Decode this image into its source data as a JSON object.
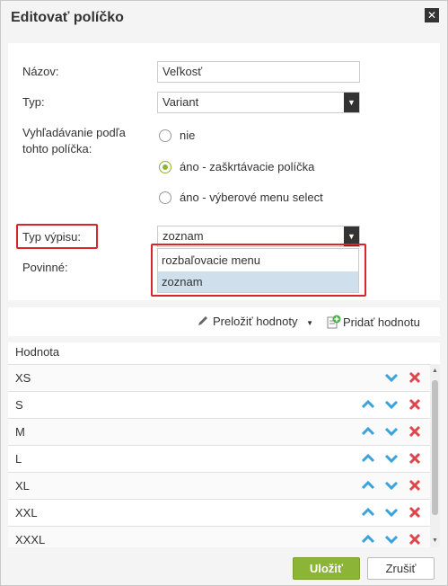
{
  "dialog": {
    "title": "Editovať políčko",
    "close_glyph": "✕"
  },
  "form": {
    "name_label": "Názov:",
    "name_value": "Veľkosť",
    "type_label": "Typ:",
    "type_value": "Variant",
    "search_label_line1": "Vyhľadávanie podľa",
    "search_label_line2": "tohto políčka:",
    "search_options": [
      {
        "label": "nie",
        "checked": false
      },
      {
        "label": "áno - zaškrtávacie políčka",
        "checked": true
      },
      {
        "label": "áno - výberové menu select",
        "checked": false
      }
    ],
    "listing_label": "Typ výpisu:",
    "listing_value": "zoznam",
    "listing_options": [
      {
        "label": "rozbaľovacie menu",
        "selected": false
      },
      {
        "label": "zoznam",
        "selected": true
      }
    ],
    "required_label": "Povinné:"
  },
  "toolbar": {
    "translate_label": "Preložiť hodnoty",
    "add_label": "Pridať hodnotu"
  },
  "table": {
    "header": "Hodnota",
    "rows": [
      "XS",
      "S",
      "M",
      "L",
      "XL",
      "XXL",
      "XXXL"
    ]
  },
  "buttons": {
    "save": "Uložiť",
    "cancel": "Zrušiť"
  },
  "colors": {
    "accent_green": "#8cb436",
    "highlight_red": "#d8262b",
    "arrow_blue": "#3aa3dc",
    "delete_red": "#e0454b"
  },
  "icons": {
    "edit": "pencil-icon",
    "add": "add-document-icon",
    "up": "chevron-up-icon",
    "down": "chevron-down-icon",
    "delete": "delete-x-icon"
  }
}
